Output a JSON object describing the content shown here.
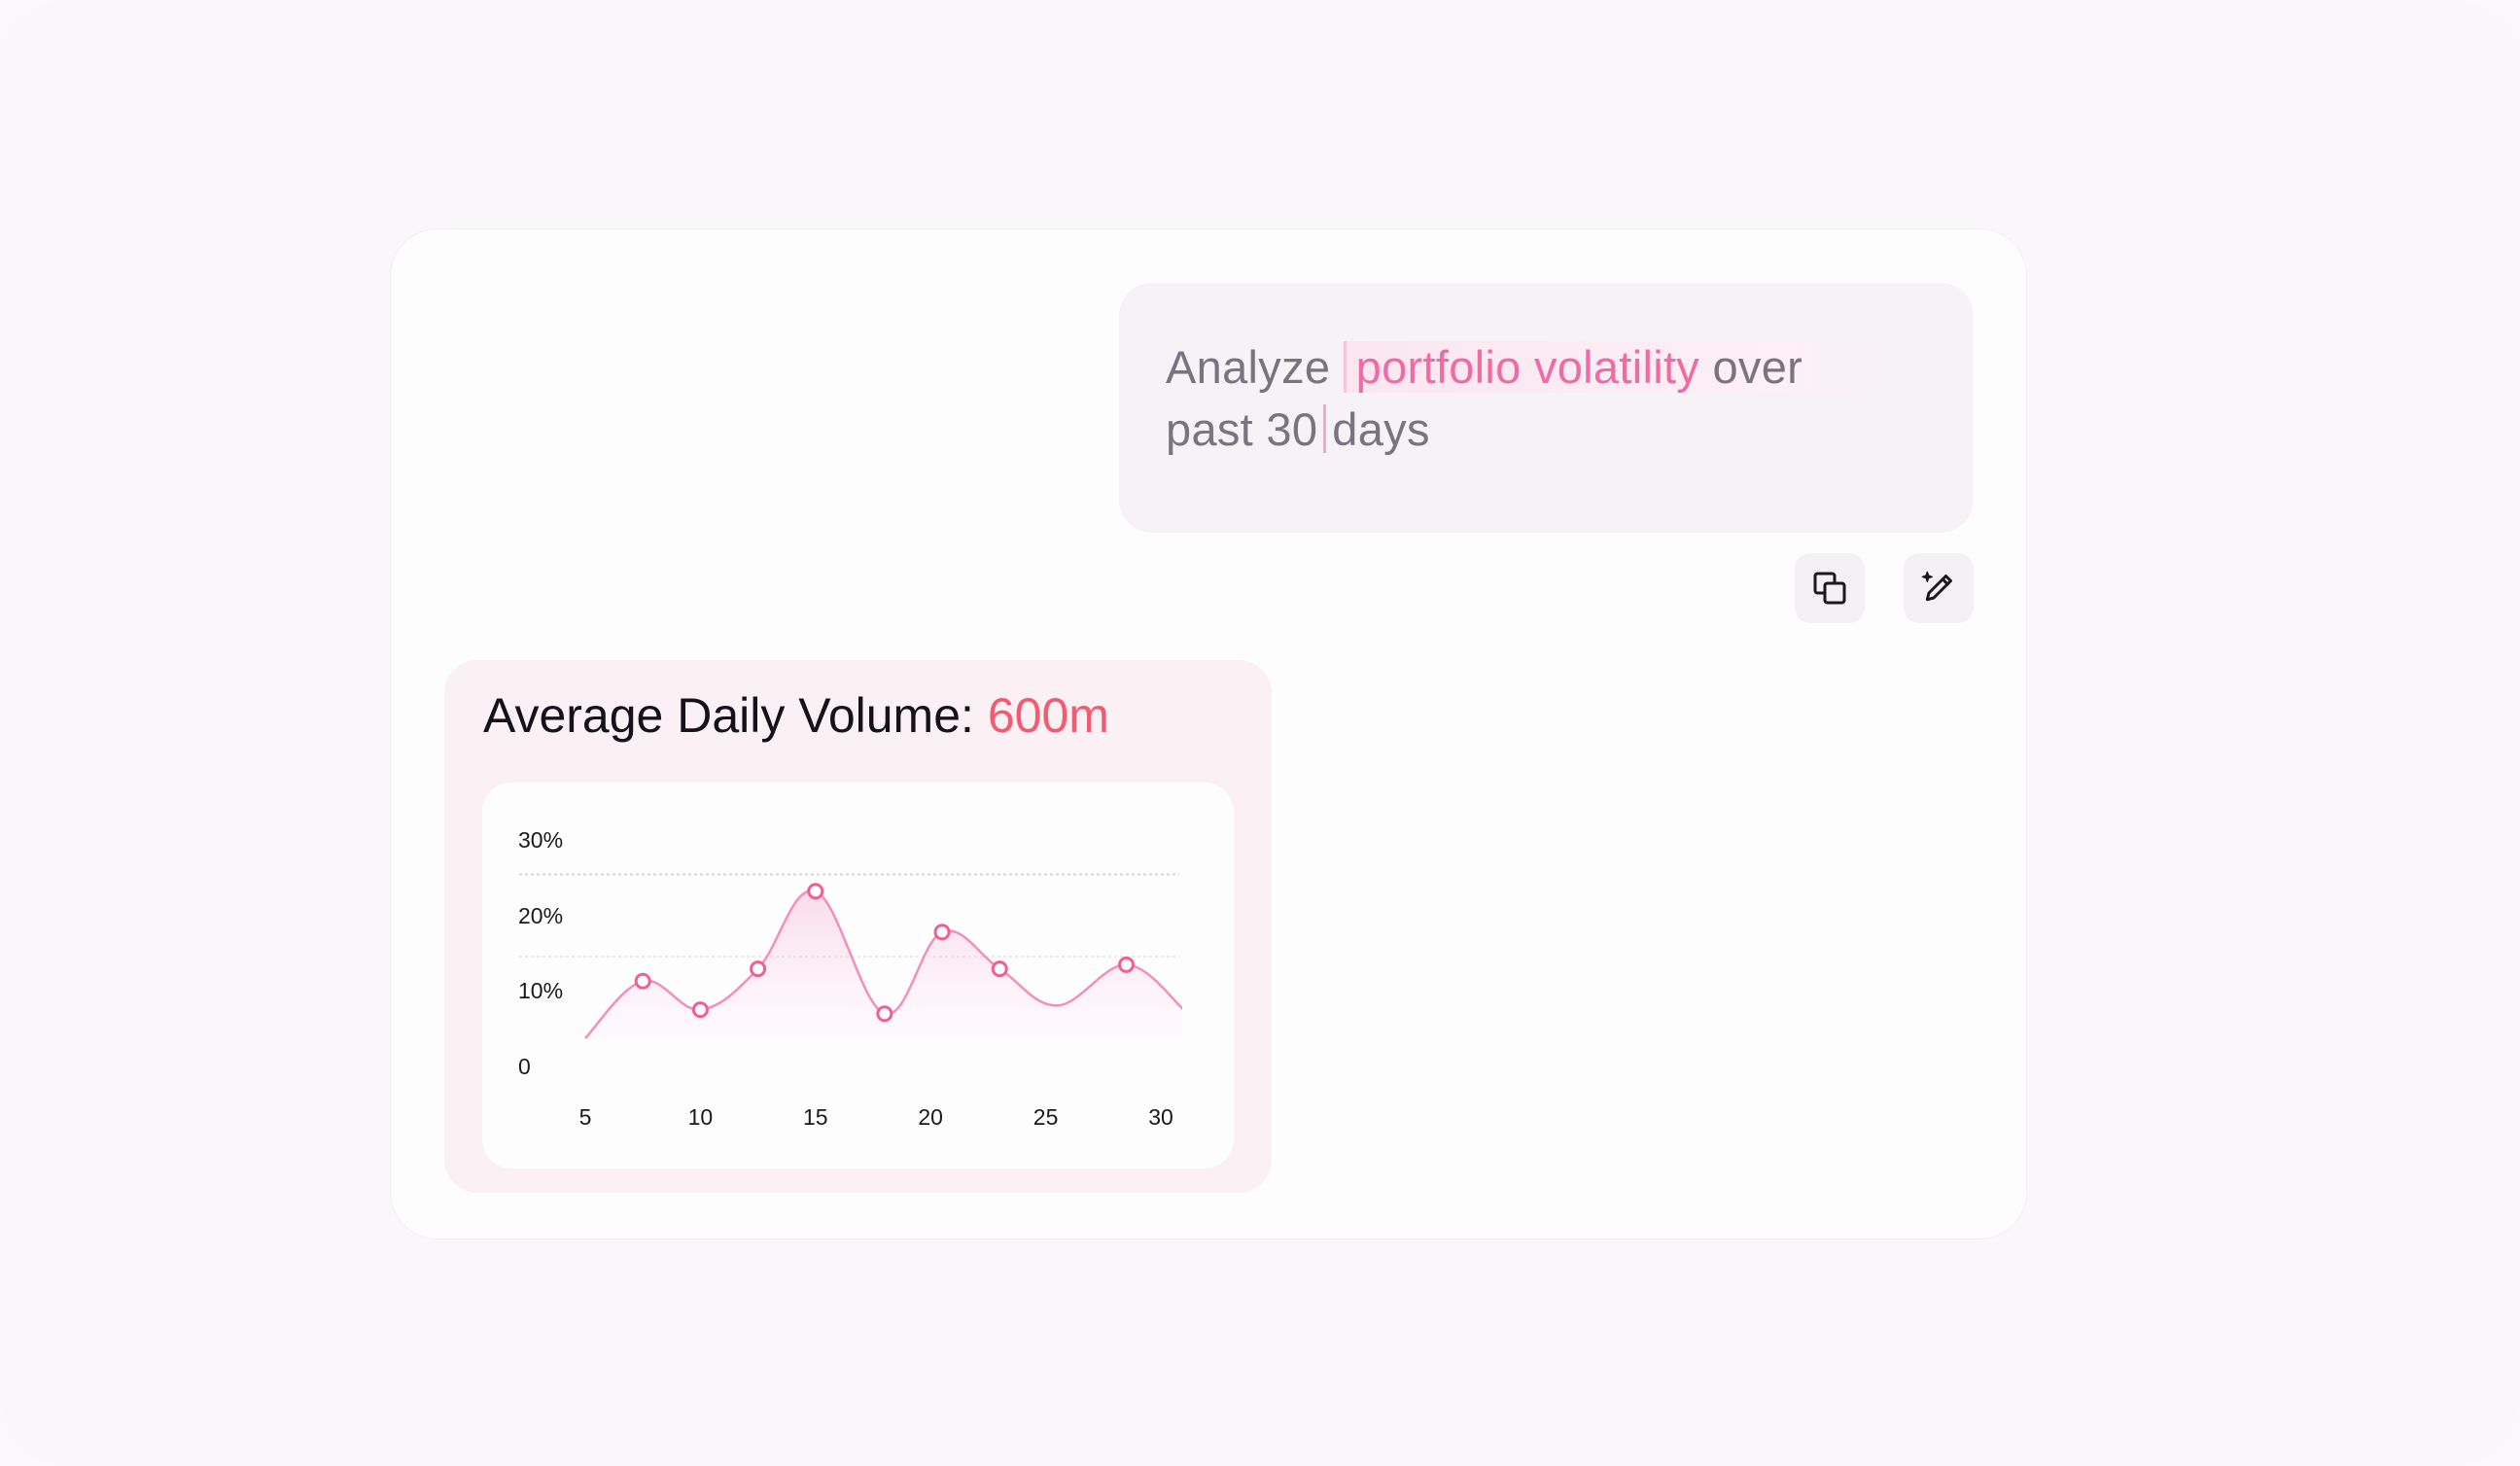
{
  "prompt": {
    "before": "Analyze",
    "highlight": "portfolio volatility",
    "after_line1": "over",
    "line2_before_caret": "past 30",
    "line2_after_caret": "days"
  },
  "actions": {
    "copy_icon": "copy-icon",
    "edit_icon": "magic-edit-icon"
  },
  "response": {
    "title_label": "Average Daily Volume:",
    "title_value": "600m"
  },
  "colors": {
    "accent": "#f06ba4",
    "value": "#f25b70",
    "line": "#f48fbb",
    "point": "#f15f92"
  },
  "chart_data": {
    "type": "area",
    "x_ticks": [
      "5",
      "10",
      "15",
      "20",
      "25",
      "30"
    ],
    "y_ticks": [
      "0",
      "10%",
      "20%",
      "30%"
    ],
    "xlim": [
      5,
      30
    ],
    "ylim": [
      0,
      30
    ],
    "grid": true,
    "x": [
      5,
      7.5,
      10,
      12.5,
      15,
      18,
      20.5,
      23,
      25.5,
      28.5,
      31
    ],
    "y": [
      0,
      7,
      3.5,
      8.5,
      18,
      3,
      13,
      8.5,
      4,
      9,
      3.5
    ],
    "markers": [
      {
        "x": 7.5,
        "y": 7
      },
      {
        "x": 10,
        "y": 3.5
      },
      {
        "x": 12.5,
        "y": 8.5
      },
      {
        "x": 15,
        "y": 18
      },
      {
        "x": 18,
        "y": 3
      },
      {
        "x": 20.5,
        "y": 13
      },
      {
        "x": 23,
        "y": 8.5
      },
      {
        "x": 28.5,
        "y": 9
      }
    ]
  }
}
